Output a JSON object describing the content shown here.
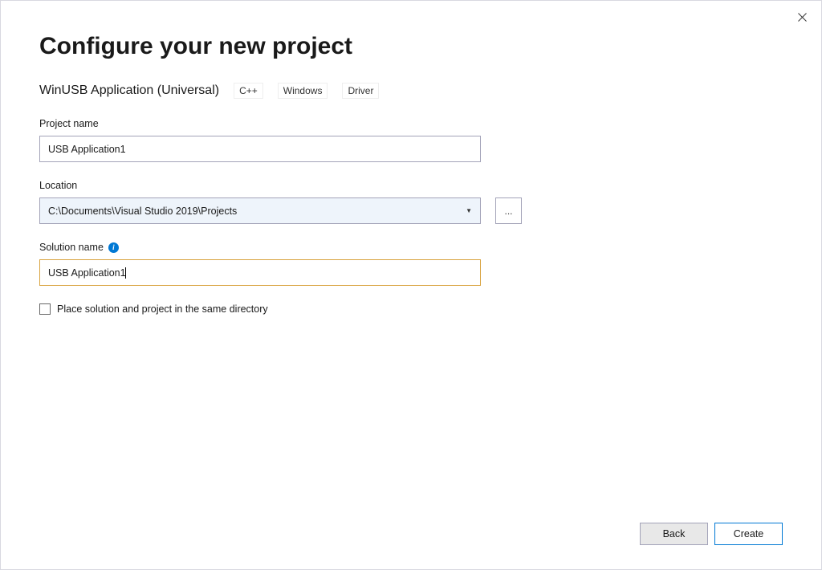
{
  "header": {
    "title": "Configure your new project"
  },
  "template": {
    "name": "WinUSB Application (Universal)",
    "tags": [
      "C++",
      "Windows",
      "Driver"
    ]
  },
  "fields": {
    "projectName": {
      "label": "Project name",
      "value": "USB Application1"
    },
    "location": {
      "label": "Location",
      "value": "C:\\Documents\\Visual Studio 2019\\Projects",
      "browseLabel": "..."
    },
    "solutionName": {
      "label": "Solution name",
      "value": "USB Application1"
    },
    "sameDirectory": {
      "label": "Place solution and project in the same directory",
      "checked": false
    }
  },
  "footer": {
    "back": "Back",
    "create": "Create"
  }
}
